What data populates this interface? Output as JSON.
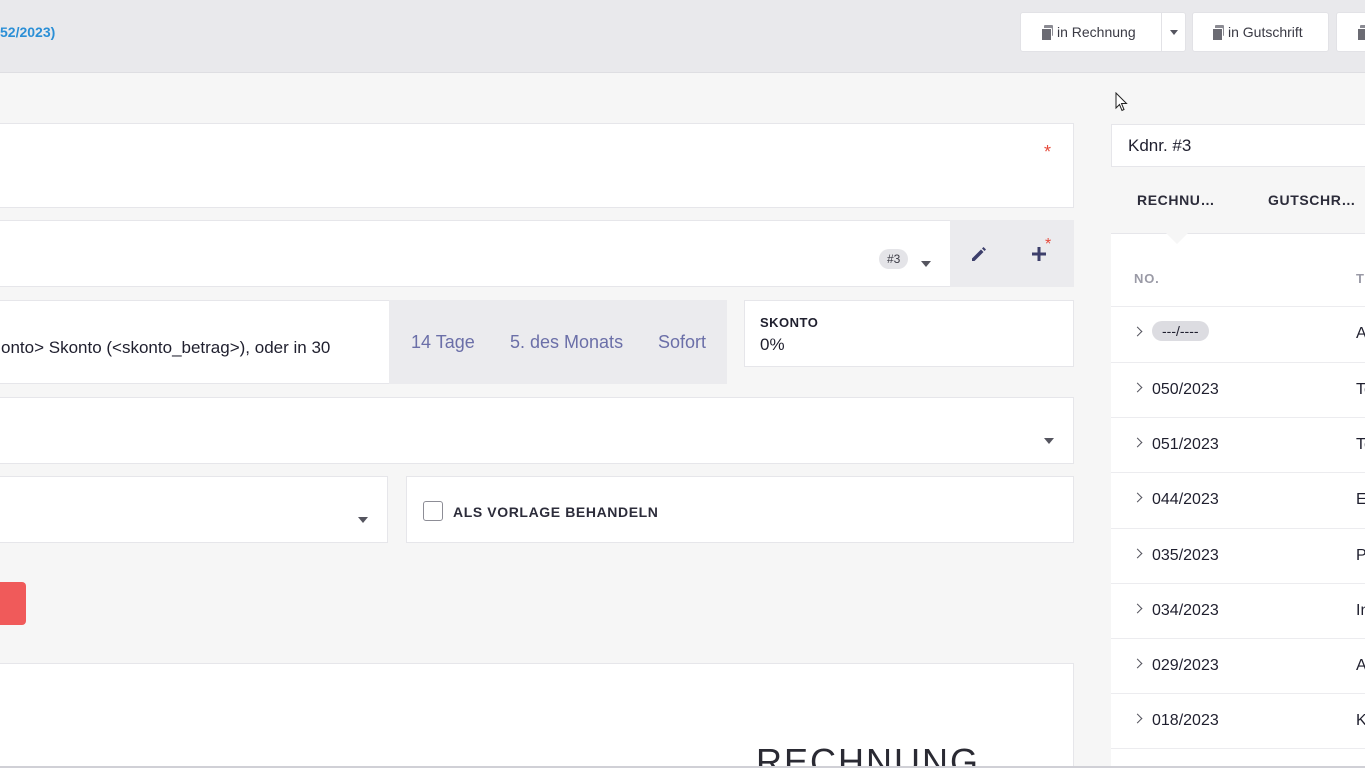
{
  "header": {
    "breadcrumb_fragment": "52/2023)",
    "buttons": [
      {
        "label": "in Rechnung"
      },
      {
        "label": "in Gutschrift"
      }
    ]
  },
  "form": {
    "required_marker": "*",
    "customer_badge": "#3",
    "add_marker": "*",
    "payment_terms_text": "onto> Skonto (<skonto_betrag>), oder in 30",
    "term_options": [
      "14 Tage",
      "5. des Monats",
      "Sofort"
    ],
    "skonto": {
      "label": "SKONTO",
      "value": "0%"
    },
    "template_checkbox": {
      "label": "ALS VORLAGE BEHANDELN",
      "checked": false
    },
    "document_title": "RECHNUNG"
  },
  "sidebar": {
    "customer": "Kdnr. #3",
    "tabs": [
      "RECHNU…",
      "GUTSCHR…"
    ],
    "columns": [
      "NO.",
      "T"
    ],
    "rows": [
      {
        "no": "---/----",
        "t": "A",
        "draft": true
      },
      {
        "no": "050/2023",
        "t": "Te"
      },
      {
        "no": "051/2023",
        "t": "Te"
      },
      {
        "no": "044/2023",
        "t": "E"
      },
      {
        "no": "035/2023",
        "t": "P"
      },
      {
        "no": "034/2023",
        "t": "In"
      },
      {
        "no": "029/2023",
        "t": "A"
      },
      {
        "no": "018/2023",
        "t": "K"
      }
    ]
  }
}
